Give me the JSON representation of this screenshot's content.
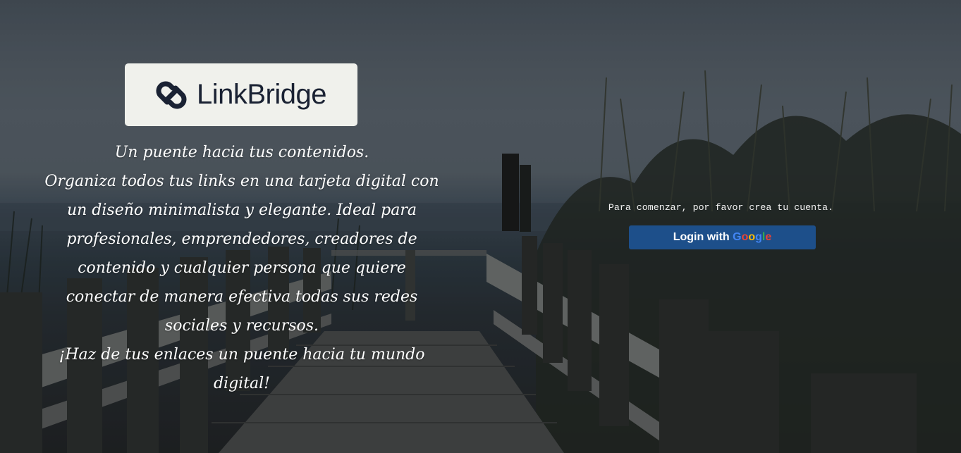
{
  "brand": {
    "name": "LinkBridge",
    "logo_icon": "chain-link-icon"
  },
  "tagline": {
    "lines": [
      "Un puente hacia tus contenidos.",
      "Organiza todos tus links en una tarjeta digital con un diseño minimalista y elegante. Ideal para profesionales, emprendedores, creadores de contenido y cualquier persona que quiere conectar de manera efectiva todas sus redes sociales y recursos.",
      "¡Haz de tus enlaces un puente hacia tu mundo digital!"
    ]
  },
  "auth": {
    "prompt": "Para comenzar, por favor crea tu cuenta.",
    "button_prefix": "Login with ",
    "google_letters": [
      "G",
      "o",
      "o",
      "g",
      "l",
      "e"
    ]
  },
  "colors": {
    "button_bg": "#1d4f8a",
    "google_blue": "#4285f4",
    "google_red": "#ea4335",
    "google_yellow": "#fbbc05",
    "google_green": "#34a853",
    "logo_card_bg": "#f0f1ec"
  }
}
